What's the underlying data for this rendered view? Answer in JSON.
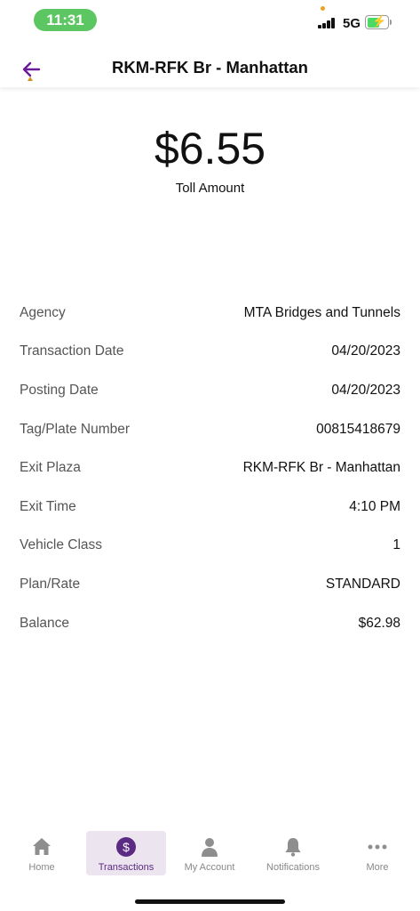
{
  "status_bar": {
    "time": "11:31",
    "network": "5G",
    "battery_level": 0.6
  },
  "header": {
    "title": "RKM-RFK Br - Manhattan",
    "back_icon": "arrow-left-icon",
    "accent_color": "#6a1b9a"
  },
  "summary": {
    "amount": "$6.55",
    "amount_label": "Toll Amount"
  },
  "details": [
    {
      "label": "Agency",
      "value": "MTA Bridges and Tunnels"
    },
    {
      "label": "Transaction Date",
      "value": "04/20/2023"
    },
    {
      "label": "Posting Date",
      "value": "04/20/2023"
    },
    {
      "label": "Tag/Plate Number",
      "value": "00815418679"
    },
    {
      "label": "Exit Plaza",
      "value": "RKM-RFK Br - Manhattan"
    },
    {
      "label": "Exit Time",
      "value": "4:10 PM"
    },
    {
      "label": "Vehicle Class",
      "value": "1"
    },
    {
      "label": "Plan/Rate",
      "value": "STANDARD"
    },
    {
      "label": "Balance",
      "value": "$62.98"
    }
  ],
  "bottom_nav": {
    "items": [
      {
        "label": "Home",
        "icon": "home-icon"
      },
      {
        "label": "Transactions",
        "icon": "dollar-circle-icon",
        "active": true
      },
      {
        "label": "My Account",
        "icon": "person-icon"
      },
      {
        "label": "Notifications",
        "icon": "bell-icon"
      },
      {
        "label": "More",
        "icon": "more-dots-icon"
      }
    ],
    "active_color": "#5b2a83",
    "active_bg": "#ece4ef"
  }
}
